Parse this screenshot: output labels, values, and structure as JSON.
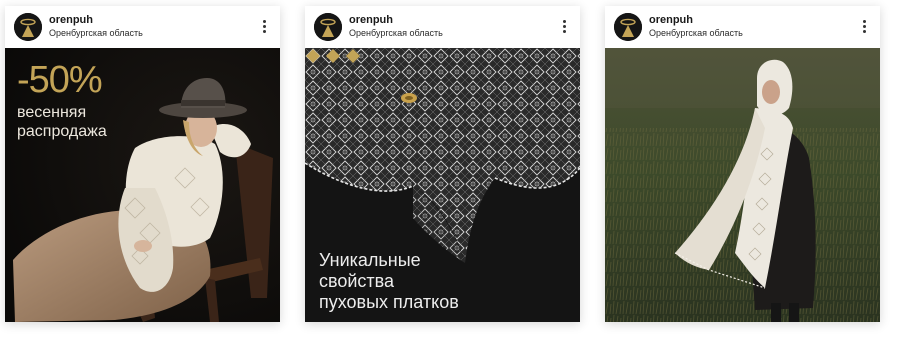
{
  "posts": [
    {
      "username": "orenpuh",
      "location": "Оренбургская область",
      "overlay": {
        "discount": "-50%",
        "line1": "весенняя",
        "line2": "распродажа"
      }
    },
    {
      "username": "orenpuh",
      "location": "Оренбургская область",
      "overlay": {
        "line1": "Уникальные",
        "line2": "свойства",
        "line3": "пуховых платков"
      }
    },
    {
      "username": "orenpuh",
      "location": "Оренбургская область"
    }
  ],
  "colors": {
    "accent_gold": "#c3a457",
    "dark_background": "#151515",
    "overlay_text": "#ece7dd"
  },
  "icons": {
    "avatar": "gold-halo-logo",
    "menu": "more-options-icon",
    "decoration": "gold-diamond-icon"
  }
}
